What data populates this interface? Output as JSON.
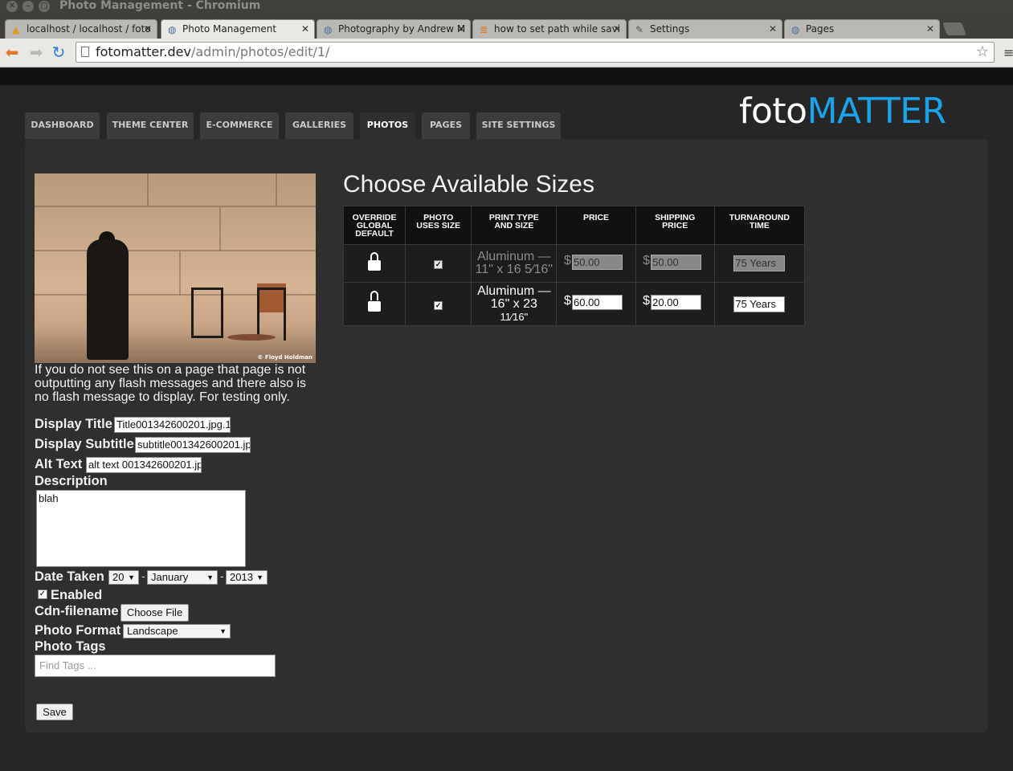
{
  "window": {
    "title": "Photo Management - Chromium"
  },
  "tabs": [
    {
      "label": "localhost / localhost / foto",
      "favicon": "pma-icon"
    },
    {
      "label": "Photo Management",
      "favicon": "globe-icon",
      "active": true
    },
    {
      "label": "Photography by Andrew M",
      "favicon": "globe-icon"
    },
    {
      "label": "how to set path while savi",
      "favicon": "stack-icon"
    },
    {
      "label": "Settings",
      "favicon": "wrench-icon"
    },
    {
      "label": "Pages",
      "favicon": "globe-icon"
    }
  ],
  "address": {
    "host": "fotomatter.dev",
    "path": "/admin/photos/edit/1/"
  },
  "logo": {
    "part1": "foto",
    "part2": "MATTER"
  },
  "nav": [
    "DASHBOARD",
    "THEME CENTER",
    "E-COMMERCE",
    "GALLERIES",
    "PHOTOS",
    "PAGES",
    "SITE SETTINGS"
  ],
  "nav_active": "PHOTOS",
  "photo": {
    "credit": "© Floyd Holdman"
  },
  "flash": "If you do not see this on a page that page is not outputting any flash messages and there also is no flash message to display. For testing only.",
  "form": {
    "display_title_label": "Display Title",
    "display_title_value": "Title001342600201.jpg.1",
    "display_subtitle_label": "Display Subtitle",
    "display_subtitle_value": "subtitle001342600201.jp",
    "alt_text_label": "Alt Text",
    "alt_text_value": "alt text 001342600201.jp",
    "description_label": "Description",
    "description_value": "blah",
    "date_taken_label": "Date Taken",
    "date_day": "20",
    "date_month": "January",
    "date_year": "2013",
    "date_sep": "-",
    "enabled_label": "Enabled",
    "enabled_checked": true,
    "cdn_label": "Cdn-filename",
    "choose_file": "Choose File",
    "photo_format_label": "Photo Format",
    "photo_format_value": "Landscape",
    "photo_tags_label": "Photo Tags",
    "tags_placeholder": "Find Tags ...",
    "save": "Save"
  },
  "sizes": {
    "heading": "Choose Available Sizes",
    "headers": [
      [
        "OVERRIDE",
        "GLOBAL",
        "DEFAULT"
      ],
      [
        "PHOTO",
        "USES SIZE"
      ],
      [
        "PRINT TYPE",
        "AND SIZE"
      ],
      [
        "PRICE"
      ],
      [
        "SHIPPING",
        "PRICE"
      ],
      [
        "TURNAROUND",
        "TIME"
      ]
    ],
    "rows": [
      {
        "lock": "locked",
        "uses_size": true,
        "type_line1": "Aluminum —",
        "type_line2": "11\" x 16 5⁄16\"",
        "currency": "$",
        "price": "50.00",
        "shipping": "50.00",
        "turnaround": "75 Years",
        "disabled": true
      },
      {
        "lock": "unlocked",
        "uses_size": true,
        "type_line1": "Aluminum —",
        "type_line2": "16\" x 23",
        "type_line3": "11⁄16\"",
        "currency": "$",
        "price": "60.00",
        "shipping": "20.00",
        "turnaround": "75 Years",
        "disabled": false
      }
    ]
  }
}
